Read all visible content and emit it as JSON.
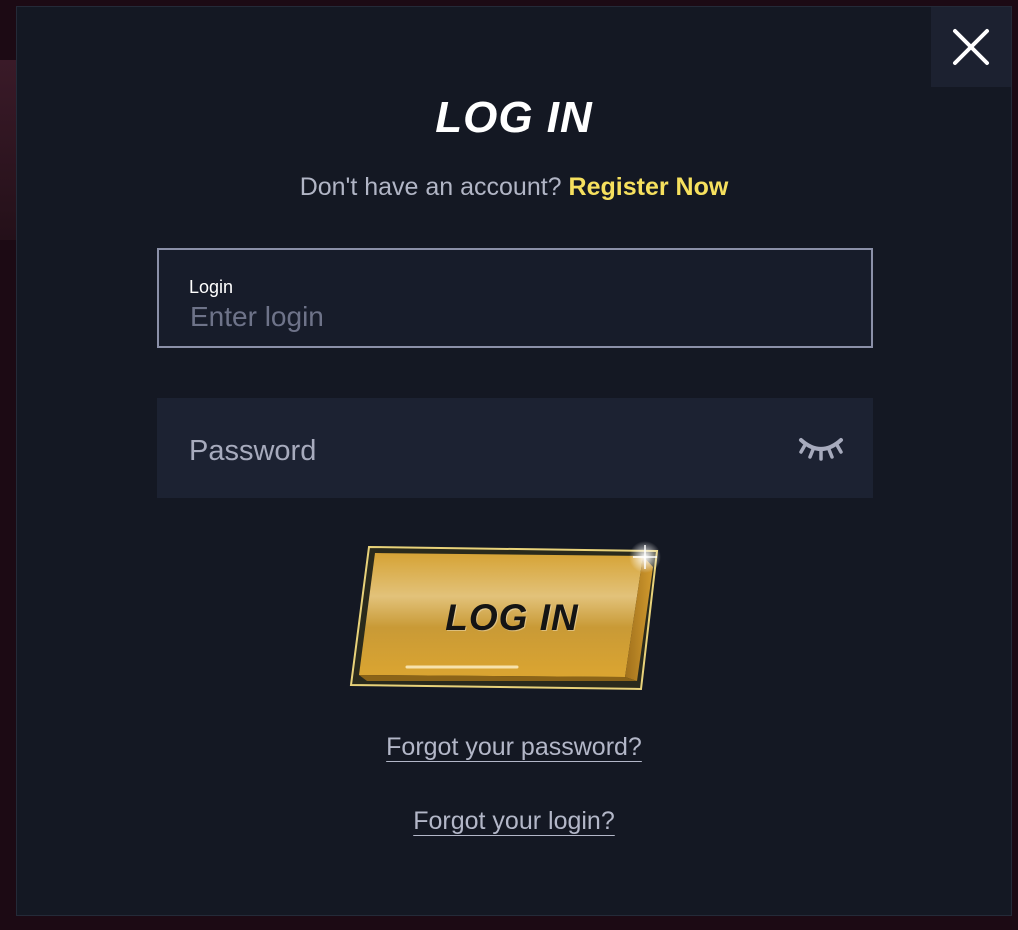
{
  "modal": {
    "title": "LOG IN",
    "subtitle_text": "Don't have an account?",
    "register_link": "Register Now"
  },
  "login_field": {
    "label": "Login",
    "placeholder": "Enter login",
    "value": ""
  },
  "password_field": {
    "placeholder": "Password",
    "value": "",
    "toggle_icon": "eye-closed-icon"
  },
  "submit_button": {
    "label": "LOG IN"
  },
  "links": {
    "forgot_password": "Forgot your password?",
    "forgot_login": "Forgot your login?"
  },
  "colors": {
    "modal_bg": "#141823",
    "accent_yellow": "#f6e05e",
    "button_gold": "#d9a731",
    "muted_text": "#b3b7c8"
  },
  "icons": {
    "close": "close-icon"
  }
}
